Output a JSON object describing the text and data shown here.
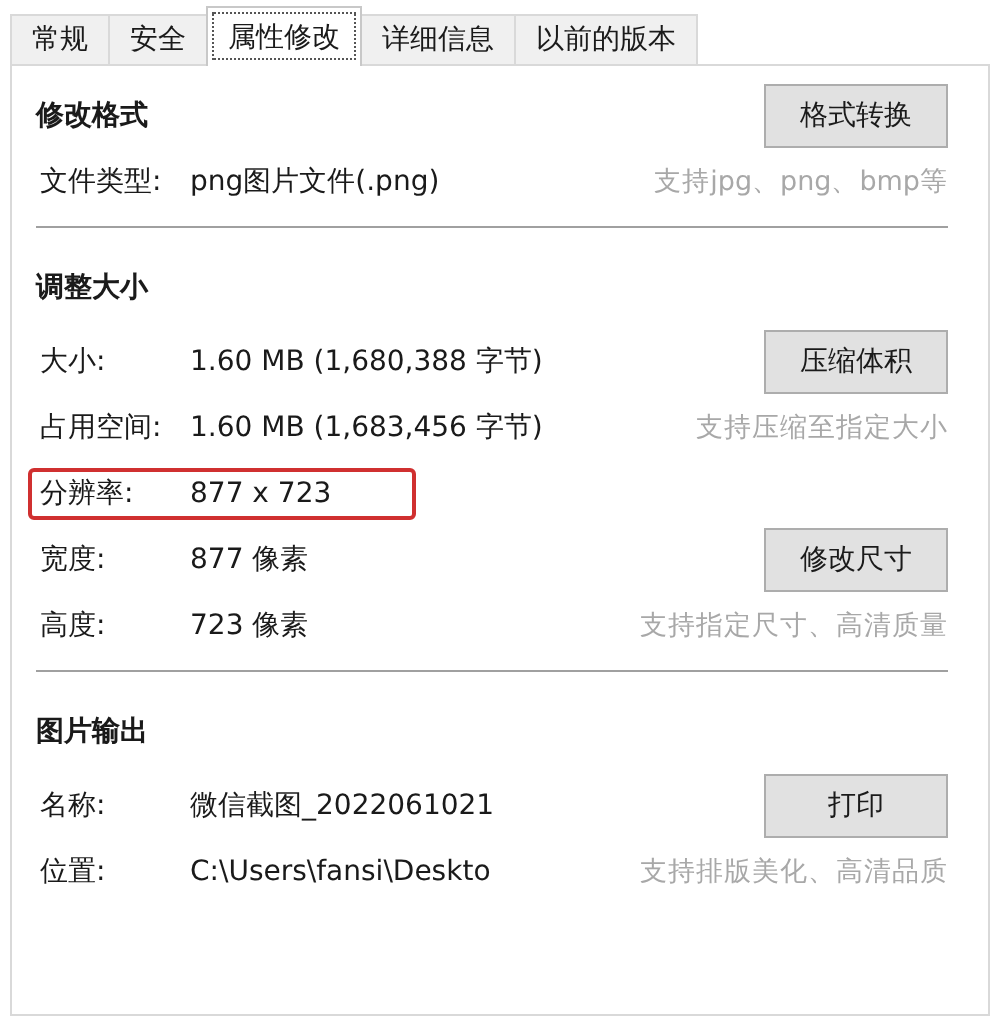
{
  "tabs": [
    {
      "label": "常规",
      "selected": false
    },
    {
      "label": "安全",
      "selected": false
    },
    {
      "label": "属性修改",
      "selected": true
    },
    {
      "label": "详细信息",
      "selected": false
    },
    {
      "label": "以前的版本",
      "selected": false
    }
  ],
  "sections": [
    {
      "title": "修改格式",
      "title_button": "格式转换",
      "rows": [
        {
          "label": "文件类型:",
          "value": "png图片文件(.png)",
          "hint": "支持jpg、png、bmp等",
          "highlighted": false
        }
      ]
    },
    {
      "title": "调整大小",
      "rows": [
        {
          "label": "大小:",
          "value": "1.60 MB (1,680,388 字节)",
          "button": "压缩体积",
          "highlighted": false
        },
        {
          "label": "占用空间:",
          "value": "1.60 MB (1,683,456 字节)",
          "hint": "支持压缩至指定大小",
          "highlighted": false
        },
        {
          "label": "分辨率:",
          "value": "877 x 723",
          "highlighted": true
        },
        {
          "label": "宽度:",
          "value": "877 像素",
          "button": "修改尺寸",
          "highlighted": false
        },
        {
          "label": "高度:",
          "value": "723 像素",
          "hint": "支持指定尺寸、高清质量",
          "highlighted": false
        }
      ]
    },
    {
      "title": "图片输出",
      "rows": [
        {
          "label": "名称:",
          "value": "微信截图_2022061021",
          "button": "打印",
          "highlighted": false
        },
        {
          "label": "位置:",
          "value": "C:\\Users\\fansi\\Deskto",
          "hint": "支持排版美化、高清品质",
          "highlighted": false
        }
      ]
    }
  ]
}
